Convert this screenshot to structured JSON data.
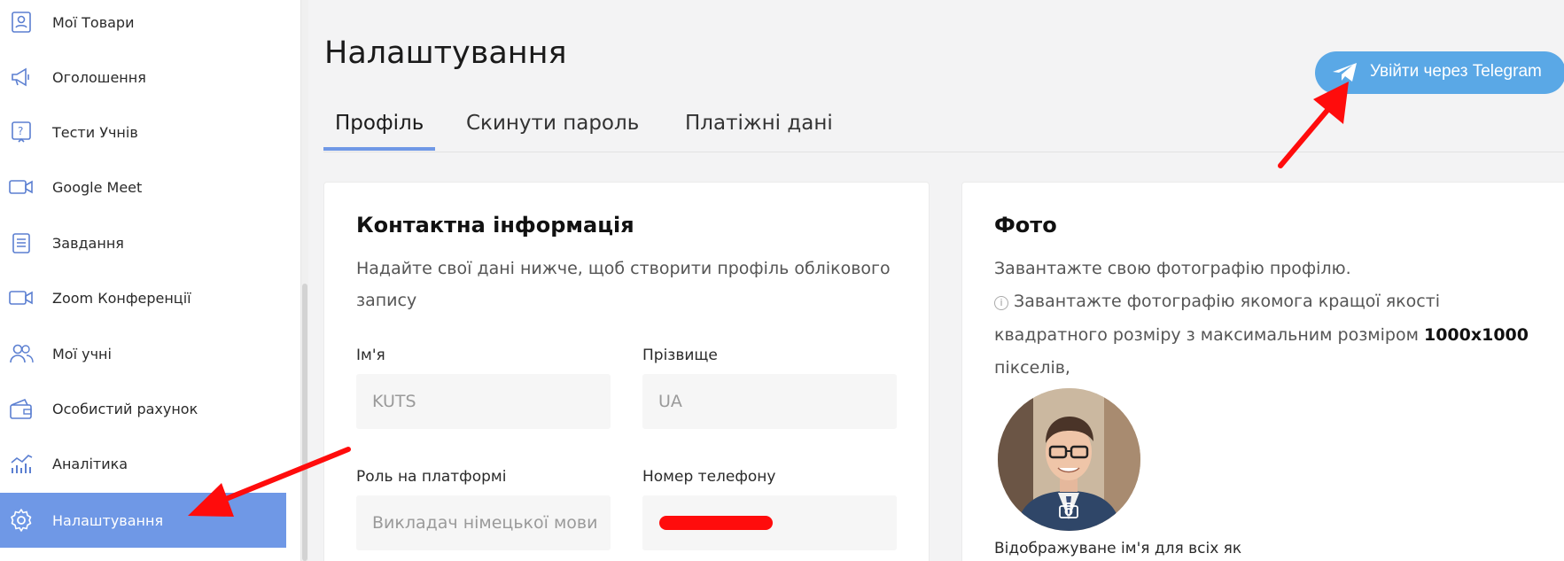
{
  "sidebar": {
    "items": [
      {
        "label": "Мої Товари",
        "icon": "user-id-icon"
      },
      {
        "label": "Оголошення",
        "icon": "megaphone-icon"
      },
      {
        "label": "Тести Учнів",
        "icon": "question-icon"
      },
      {
        "label": "Google Meet",
        "icon": "video-camera-icon"
      },
      {
        "label": "Завдання",
        "icon": "clipboard-icon"
      },
      {
        "label": "Zoom Конференції",
        "icon": "video-camera-icon"
      },
      {
        "label": "Мої учні",
        "icon": "users-icon"
      },
      {
        "label": "Особистий рахунок",
        "icon": "wallet-icon"
      },
      {
        "label": "Аналітика",
        "icon": "analytics-icon"
      },
      {
        "label": "Налаштування",
        "icon": "gear-icon",
        "active": true
      }
    ]
  },
  "header": {
    "title": "Налаштування",
    "telegram_button": "Увійти через Telegram"
  },
  "tabs": [
    {
      "label": "Профіль",
      "active": true
    },
    {
      "label": "Скинути пароль"
    },
    {
      "label": "Платіжні дані"
    }
  ],
  "contact": {
    "title": "Контактна інформація",
    "desc_line1": "Надайте свої дані нижче, щоб створити профіль облікового",
    "desc_line2": "запису",
    "first_name_label": "Ім'я",
    "first_name_value": "KUTS",
    "last_name_label": "Прізвище",
    "last_name_value": "UA",
    "role_label": "Роль на платформі",
    "role_value": "Викладач німецької мови",
    "phone_label": "Номер телефону"
  },
  "photo": {
    "title": "Фото",
    "line1": "Завантажте свою фотографію профілю.",
    "line2": "Завантажте фотографію якомога кращої якості",
    "line3_prefix": "квадратного розміру з максимальним розміром",
    "line3_bold": "1000x1000",
    "line4": "пікселів,",
    "display_name_label": "Відображуване ім'я для всіх як"
  },
  "colors": {
    "accent": "#6f98e6",
    "telegram": "#5aa8e6",
    "annotation_arrow": "#ff0c0c"
  }
}
